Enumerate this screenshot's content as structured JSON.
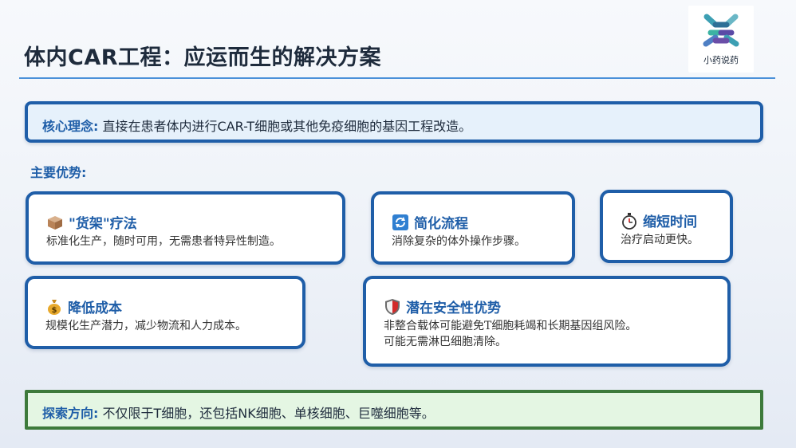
{
  "slide": {
    "title": "体内CAR工程：应运而生的解决方案",
    "logo_text": "小药说药"
  },
  "core": {
    "label": "核心理念:",
    "text": " 直接在患者体内进行CAR-T细胞或其他免疫细胞的基因工程改造。"
  },
  "advantages_title": "主要优势:",
  "cards": [
    {
      "icon": "package-icon",
      "title": "\"货架\"疗法",
      "lines": [
        "标准化生产，随时可用，无需患者特异性制造。"
      ]
    },
    {
      "icon": "refresh-icon",
      "title": "简化流程",
      "lines": [
        "消除复杂的体外操作步骤。"
      ]
    },
    {
      "icon": "stopwatch-icon",
      "title": "缩短时间",
      "lines": [
        "治疗启动更快。"
      ]
    },
    {
      "icon": "money-bag-icon",
      "title": "降低成本",
      "lines": [
        "规模化生产潜力，减少物流和人力成本。"
      ]
    },
    {
      "icon": "shield-icon",
      "title": "潜在安全性优势",
      "lines": [
        "非整合载体可能避免T细胞耗竭和长期基因组风险。",
        "可能无需淋巴细胞清除。"
      ]
    }
  ],
  "explore": {
    "label": "探索方向:",
    "text": " 不仅限于T细胞，还包括NK细胞、单核细胞、巨噬细胞等。"
  },
  "colors": {
    "accent": "#1f5ea8",
    "rule": "#4a90d9",
    "explore_border": "#3d7a3b",
    "explore_bg": "#e4f6e3",
    "core_bg": "#e6f1fb"
  }
}
